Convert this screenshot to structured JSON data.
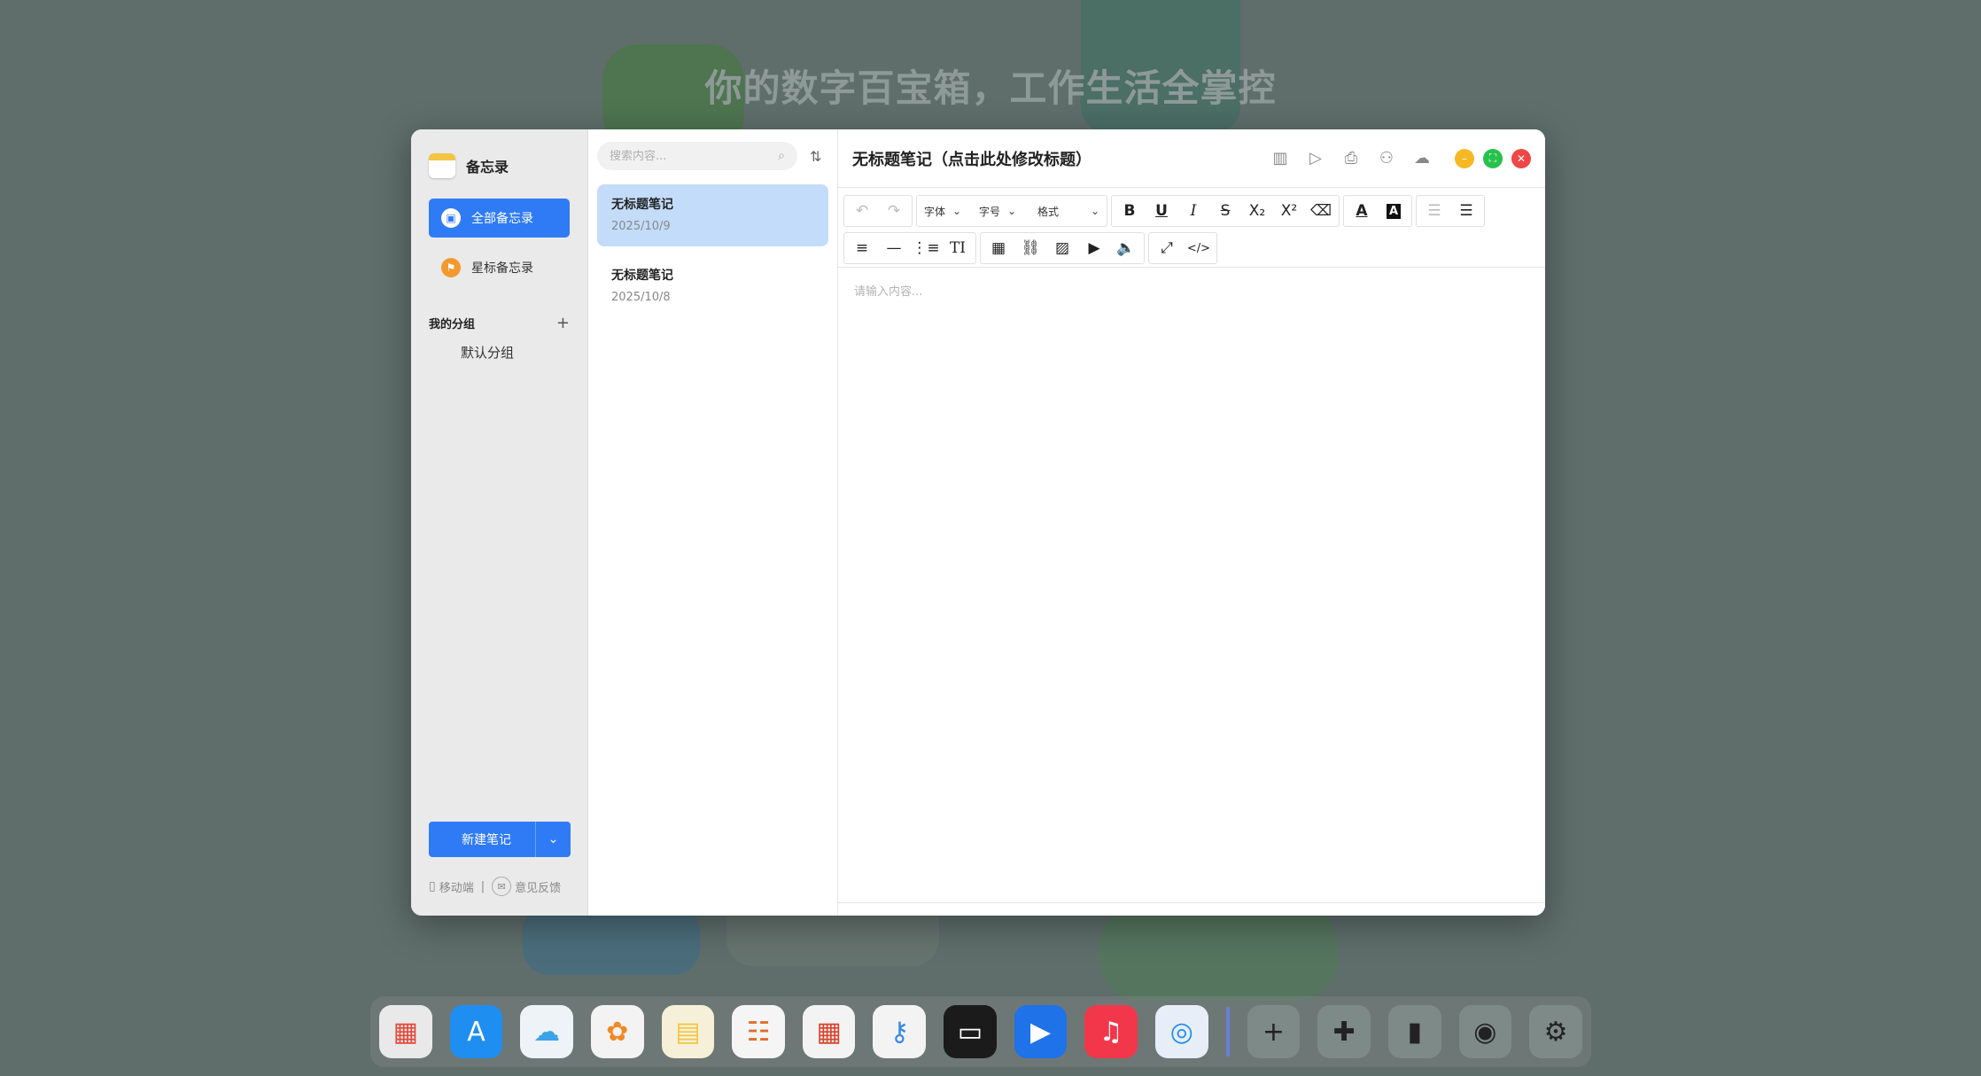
{
  "desktop": {
    "headline": "你的数字百宝箱，工作生活全掌控"
  },
  "sidebar": {
    "app_title": "备忘录",
    "nav": [
      {
        "label": "全部备忘录",
        "icon": "box-icon",
        "active": true
      },
      {
        "label": "星标备忘录",
        "icon": "flag-icon",
        "active": false
      }
    ],
    "group_header": "我的分组",
    "group_add": "+",
    "groups": [
      {
        "label": "默认分组"
      }
    ],
    "new_note_label": "新建笔记",
    "footer": {
      "mobile": "移动端",
      "separator": "|",
      "feedback": "意见反馈"
    }
  },
  "notelist": {
    "search_placeholder": "搜索内容...",
    "notes": [
      {
        "title": "无标题笔记",
        "date": "2025/10/9",
        "active": true
      },
      {
        "title": "无标题笔记",
        "date": "2025/10/8",
        "active": false
      }
    ]
  },
  "editor": {
    "title": "无标题笔记（点击此处修改标题）",
    "placeholder": "请输入内容...",
    "toolbar": {
      "font_label": "字体",
      "size_label": "字号",
      "format_label": "格式"
    }
  },
  "colors": {
    "accent": "#2f7bf6",
    "selected_note": "#c3dcfa",
    "window_min": "#f6b824",
    "window_max": "#27c24c",
    "window_close": "#ef4646"
  },
  "dock": {
    "apps": [
      "launchpad-icon",
      "app-store-icon",
      "icloud-icon",
      "photos-icon",
      "notes-icon",
      "reminders-icon",
      "calendar-icon",
      "keychain-icon",
      "wallet-icon",
      "video-icon",
      "music-icon",
      "safari-icon",
      "add-icon",
      "puzzle-icon",
      "brush-icon",
      "lock-icon",
      "settings-icon"
    ]
  }
}
